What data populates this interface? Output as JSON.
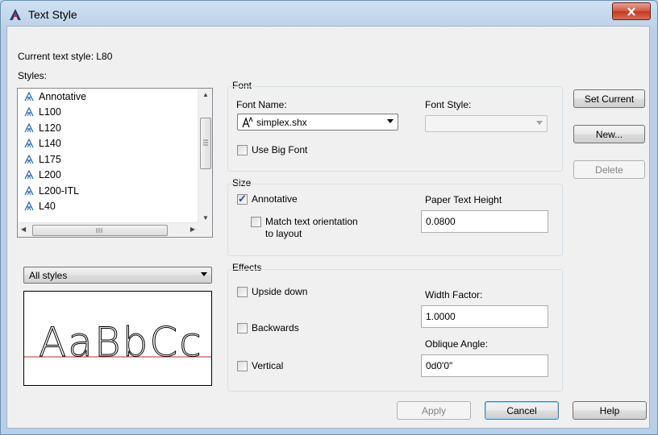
{
  "window": {
    "title": "Text Style",
    "close_label": "X"
  },
  "current_style": {
    "label": "Current text style:",
    "value": "L80"
  },
  "styles": {
    "label": "Styles:",
    "items": [
      "Annotative",
      "L100",
      "L120",
      "L140",
      "L175",
      "L200",
      "L200-ITL",
      "L40"
    ],
    "filter_value": "All styles"
  },
  "preview": {
    "text": "AaBbCc"
  },
  "font": {
    "group_title": "Font",
    "font_name_label": "Font Name:",
    "font_name_value": "simplex.shx",
    "font_style_label": "Font Style:",
    "font_style_value": "",
    "use_big_font_label": "Use Big Font",
    "use_big_font_checked": false
  },
  "size": {
    "group_title": "Size",
    "annotative_label": "Annotative",
    "annotative_checked": true,
    "match_orientation_label_line1": "Match text orientation",
    "match_orientation_label_line2": "to layout",
    "match_orientation_checked": false,
    "paper_height_label": "Paper Text Height",
    "paper_height_value": "0.0800"
  },
  "effects": {
    "group_title": "Effects",
    "upside_down_label": "Upside down",
    "backwards_label": "Backwards",
    "vertical_label": "Vertical",
    "width_factor_label": "Width Factor:",
    "width_factor_value": "1.0000",
    "oblique_angle_label": "Oblique Angle:",
    "oblique_angle_value": "0d0'0\""
  },
  "side_buttons": {
    "set_current": "Set Current",
    "new": "New...",
    "delete": "Delete"
  },
  "footer_buttons": {
    "apply": "Apply",
    "cancel": "Cancel",
    "help": "Help"
  },
  "colors": {
    "accent": "#1e4fa6",
    "close_red": "#c23a24"
  }
}
